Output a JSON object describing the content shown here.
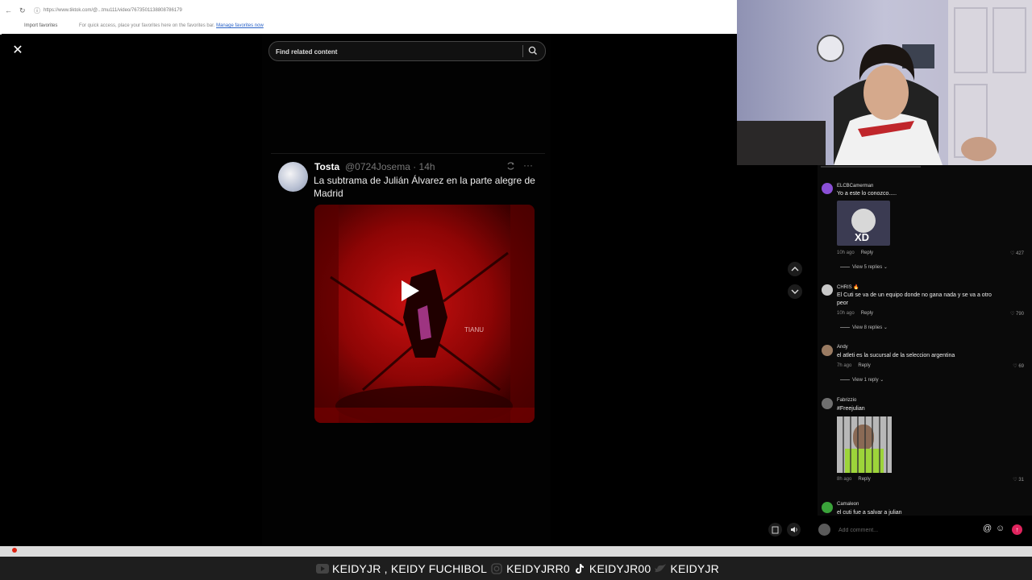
{
  "browser": {
    "url": "https://www.tiktok.com/@...tmu111/video/7673501138808786179",
    "favorites_label": "Import favorites",
    "favbar_message": "For quick access, place your favorites here on the favorites bar.",
    "favbar_link": "Manage favorites now"
  },
  "search": {
    "placeholder": "Find related content"
  },
  "tweet": {
    "name": "Tosta",
    "handle_time": "@0724Josema · 14h",
    "text": "La subtrama de Julián Álvarez en la parte alegre de Madrid",
    "media_watermark": "TIANU"
  },
  "comments": [
    {
      "user": "ELCBCamerman",
      "text": "Yo a este lo conozco.....",
      "time": "10h ago",
      "reply": "Reply",
      "likes": "427",
      "view": "View 5 replies",
      "has_image": true,
      "image_text": "XD",
      "avatar_color": "#8a4fd6"
    },
    {
      "user": "CHRIS 🔥",
      "text": "El Cuti se va de un equipo donde no gana nada y se va a otro peor",
      "time": "10h ago",
      "reply": "Reply",
      "likes": "790",
      "view": "View 8 replies",
      "has_image": false,
      "avatar_color": "#c9c9c9"
    },
    {
      "user": "Andy",
      "text": "el atleti es la sucursal de la seleccion argentina",
      "time": "7h ago",
      "reply": "Reply",
      "likes": "69",
      "view": "View 1 reply",
      "has_image": false,
      "avatar_color": "#9a7b62"
    },
    {
      "user": "Fabrizzio",
      "text": "#Freejulian",
      "time": "8h ago",
      "reply": "Reply",
      "likes": "31",
      "view": "",
      "has_image": true,
      "avatar_color": "#6f6f6f"
    },
    {
      "user": "Camaleon",
      "text": "el cuti fue a salvar a julian",
      "time": "",
      "reply": "",
      "likes": "",
      "view": "",
      "has_image": false,
      "avatar_color": "#3aa33a"
    }
  ],
  "comment_bar": {
    "placeholder": "Add comment..."
  },
  "social": {
    "youtube": "KEIDYJR , KEIDY FUCHIBOL",
    "instagram": "KEIDYJRR0",
    "tiktok": "KEIDYJR00",
    "twitter": "KEIDYJR"
  }
}
